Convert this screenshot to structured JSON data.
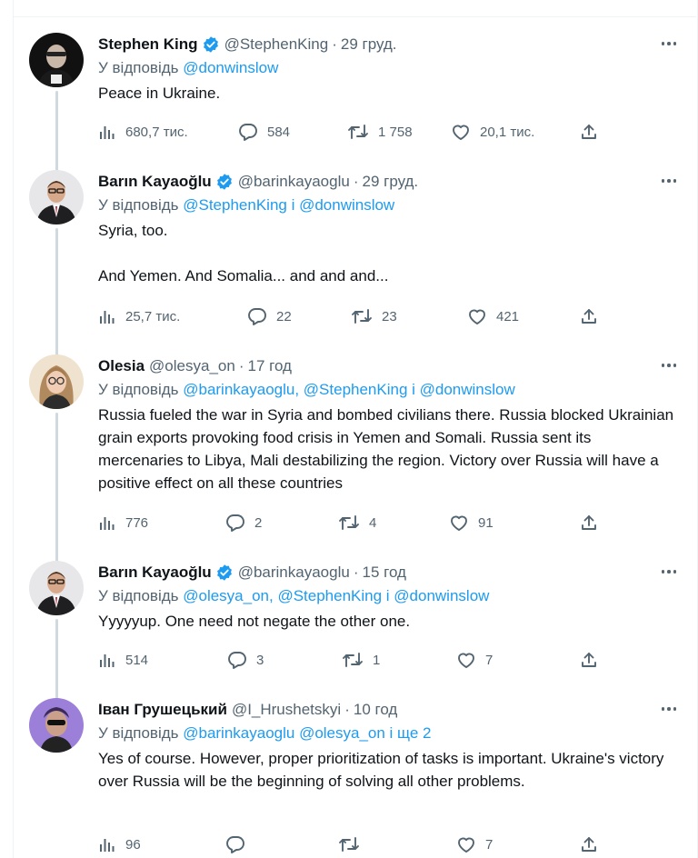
{
  "colors": {
    "accent": "#1d9bf0",
    "text": "#0f1419",
    "muted": "#536471",
    "thread_line": "#cfd9de"
  },
  "icons": {
    "views": "bar-chart-icon",
    "reply": "speech-bubble-icon",
    "retweet": "retweet-arrows-icon",
    "like": "heart-outline-icon",
    "share": "upload-arrow-icon",
    "verified": "verified-badge-icon",
    "more": "more-dots-icon"
  },
  "tweets": [
    {
      "name": "Stephen King",
      "verified": true,
      "handle": "@StephenKing",
      "dot": "·",
      "time": "29 груд.",
      "reply_prefix": "У відповідь",
      "reply_mentions": "@donwinslow",
      "body": [
        "Peace in Ukraine."
      ],
      "views": "680,7 тис.",
      "replies": "584",
      "retweets": "1 758",
      "likes": "20,1 тис."
    },
    {
      "name": "Barın Kayaoğlu",
      "verified": true,
      "handle": "@barinkayaoglu",
      "dot": "·",
      "time": "29 груд.",
      "reply_prefix": "У відповідь",
      "reply_mentions": "@StephenKing і @donwinslow",
      "body": [
        "Syria, too.",
        "And Yemen. And Somalia... and and and..."
      ],
      "views": "25,7 тис.",
      "replies": "22",
      "retweets": "23",
      "likes": "421"
    },
    {
      "name": "Olesia",
      "verified": false,
      "handle": "@olesya_on",
      "dot": "·",
      "time": "17 год",
      "reply_prefix": "У відповідь",
      "reply_mentions": "@barinkayaoglu, @StephenKing і @donwinslow",
      "body": [
        "Russia fueled the war in Syria and bombed civilians there. Russia blocked Ukrainian grain exports provoking food crisis in Yemen and Somali. Russia sent its mercenaries to Libya, Mali destabilizing the region. Victory over Russia will have a positive effect on all these countries"
      ],
      "views": "776",
      "replies": "2",
      "retweets": "4",
      "likes": "91"
    },
    {
      "name": "Barın Kayaoğlu",
      "verified": true,
      "handle": "@barinkayaoglu",
      "dot": "·",
      "time": "15 год",
      "reply_prefix": "У відповідь",
      "reply_mentions": "@olesya_on, @StephenKing і @donwinslow",
      "body": [
        "Yyyyyup. One need not negate the other one."
      ],
      "views": "514",
      "replies": "3",
      "retweets": "1",
      "likes": "7"
    },
    {
      "name": "Іван Грушецький",
      "verified": false,
      "handle": "@I_Hrushetskyi",
      "dot": "·",
      "time": "10 год",
      "reply_prefix": "У відповідь",
      "reply_mentions": "@barinkayaoglu @olesya_on і ще 2",
      "body": [
        "Yes of course. However, proper prioritization of tasks is important. Ukraine's victory over Russia will be the beginning of solving all other problems."
      ],
      "views": "96",
      "replies": "",
      "retweets": "",
      "likes": "7"
    }
  ]
}
